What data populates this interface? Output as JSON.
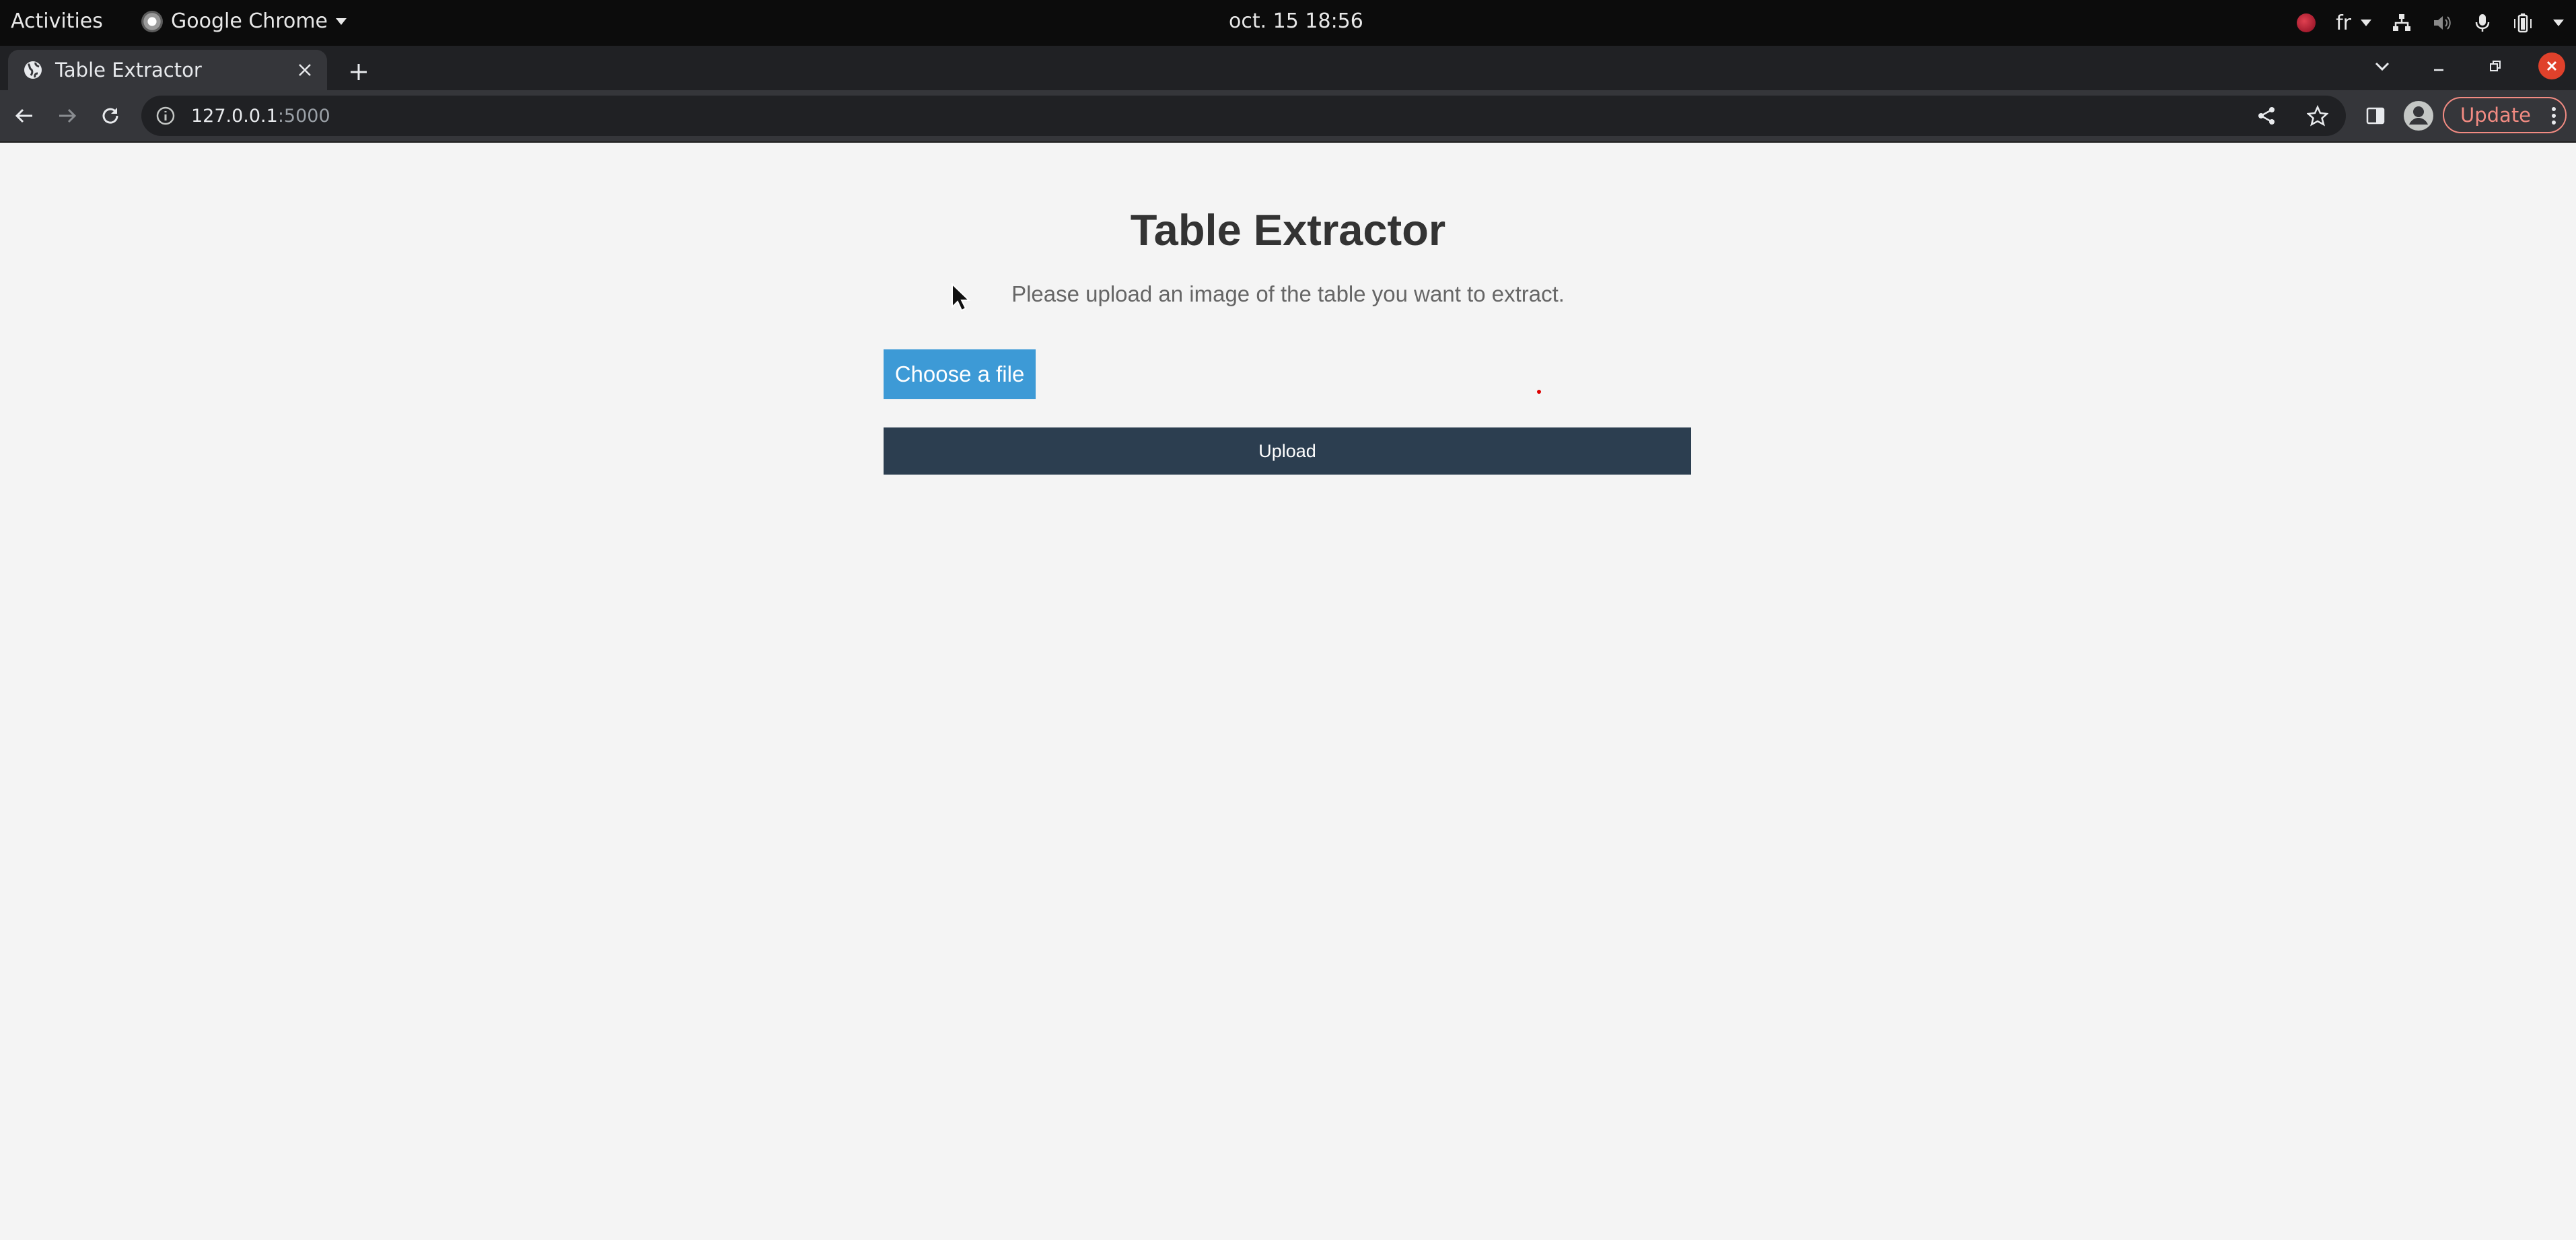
{
  "system_bar": {
    "activities": "Activities",
    "app_name": "Google Chrome",
    "clock": "oct. 15  18:56",
    "keyboard_layout": "fr"
  },
  "browser": {
    "tab_title": "Table Extractor",
    "url_host": "127.0.0.1",
    "url_port": ":5000",
    "update_label": "Update",
    "accent_update": "#f28b82"
  },
  "page": {
    "title": "Table Extractor",
    "instructions": "Please upload an image of the table you want to extract.",
    "choose_label": "Choose a file",
    "upload_label": "Upload",
    "colors": {
      "choose_button": "#3d9ad6",
      "upload_button": "#2c3e50",
      "background": "#f4f4f4"
    }
  },
  "icons": [
    "chrome-app-icon",
    "recording-indicator-icon",
    "network-icon",
    "volume-icon",
    "microphone-icon",
    "battery-icon",
    "globe-icon",
    "close-icon",
    "plus-icon",
    "chevron-down-icon",
    "minimize-icon",
    "restore-icon",
    "back-icon",
    "forward-icon",
    "reload-icon",
    "info-icon",
    "share-icon",
    "star-icon",
    "side-panel-icon",
    "profile-icon",
    "more-icon",
    "cursor-icon"
  ]
}
